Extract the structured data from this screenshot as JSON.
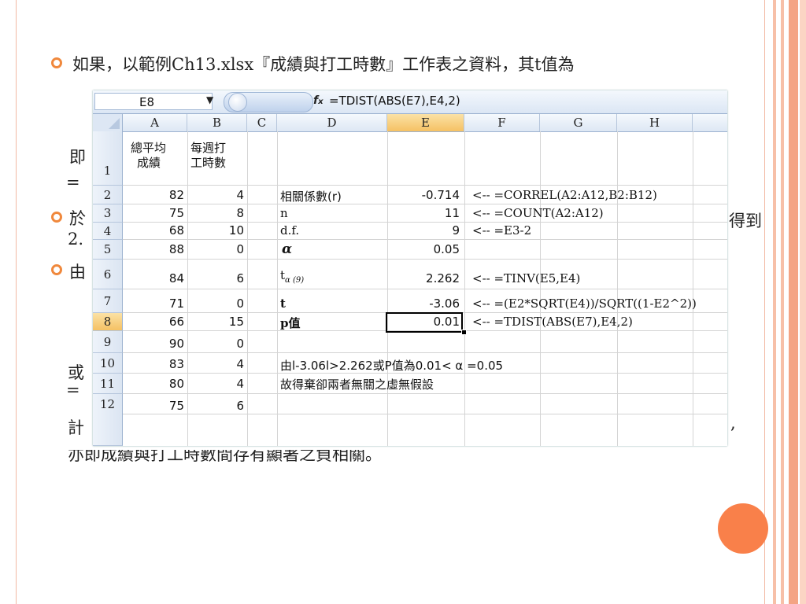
{
  "slide": {
    "bullet1": "如果，以範例Ch13.xlsx『成績與打工時數』工作表之資料，其t值為",
    "partial_left": [
      "即",
      "=",
      "於",
      "2.",
      "由",
      "或",
      "=",
      "計"
    ],
    "partial_right": [
      "得到",
      ","
    ],
    "bottom_line": "亦即成績與打工時數間存有顯著之負相關。"
  },
  "excel": {
    "name_box": "E8",
    "fx": "fx",
    "formula": "=TDIST(ABS(E7),E4,2)",
    "columns": [
      "A",
      "B",
      "C",
      "D",
      "E",
      "F",
      "G",
      "H"
    ],
    "rows": [
      "1",
      "2",
      "3",
      "4",
      "5",
      "6",
      "7",
      "8",
      "9",
      "10",
      "11",
      "12"
    ],
    "header_a": [
      "總平均",
      "成績"
    ],
    "header_b": [
      "每週打",
      "工時數"
    ],
    "col_a": [
      "82",
      "75",
      "68",
      "88",
      "84",
      "71",
      "66",
      "90",
      "83",
      "80",
      "75"
    ],
    "col_b": [
      "4",
      "8",
      "10",
      "0",
      "6",
      "0",
      "15",
      "0",
      "4",
      "4",
      "6"
    ],
    "d_labels": {
      "r2": "相關係數(r)",
      "r3": "n",
      "r4": "d.f.",
      "r5": "α",
      "r6_main": "t",
      "r6_sub": "α (9)",
      "r7": "t",
      "r8": "p值",
      "r10": "由l-3.06l>2.262或P值為0.01< α =0.05",
      "r11": "故得棄卻兩者無關之虛無假設"
    },
    "e_values": {
      "r2": "-0.714",
      "r3": "11",
      "r4": "9",
      "r5": "0.05",
      "r6": "2.262",
      "r7": "-3.06",
      "r8": "0.01"
    },
    "f_notes": {
      "r2": "<--  =CORREL(A2:A12,B2:B12)",
      "r3": "<--  =COUNT(A2:A12)",
      "r4": "<--  =E3-2",
      "r6": "<--  =TINV(E5,E4)",
      "r7": "<--  =(E2*SQRT(E4))/SQRT((1-E2^2))",
      "r8": "<--  =TDIST(ABS(E7),E4,2)"
    }
  },
  "colors": {
    "accent": "#f9804a",
    "bullet": "#f0883c",
    "selected_header": "#f5c163"
  }
}
